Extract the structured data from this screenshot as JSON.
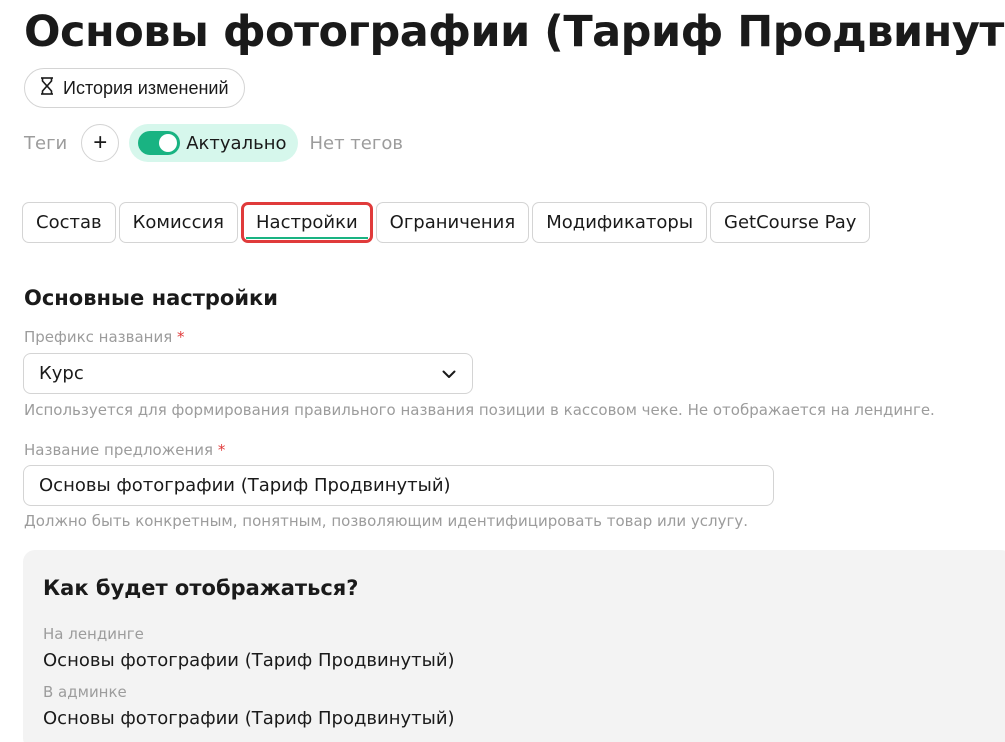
{
  "page": {
    "title": "Основы фотографии (Тариф Продвинутый)"
  },
  "header": {
    "history_label": "История изменений"
  },
  "tags": {
    "label": "Теги",
    "add_symbol": "+",
    "toggle_label": "Актуально",
    "toggle_on": true,
    "empty_text": "Нет тегов"
  },
  "tabs": [
    {
      "label": "Состав",
      "active": false
    },
    {
      "label": "Комиссия",
      "active": false
    },
    {
      "label": "Настройки",
      "active": true
    },
    {
      "label": "Ограничения",
      "active": false
    },
    {
      "label": "Модификаторы",
      "active": false
    },
    {
      "label": "GetCourse Pay",
      "active": false
    }
  ],
  "settings": {
    "section_title": "Основные настройки",
    "prefix": {
      "label": "Префикс названия",
      "required_mark": "*",
      "value": "Курс",
      "hint": "Используется для формирования правильного названия позиции в кассовом чеке. Не отображается на лендинге."
    },
    "offer_name": {
      "label": "Название предложения",
      "required_mark": "*",
      "value": "Основы фотографии (Тариф Продвинутый)",
      "hint": "Должно быть конкретным, понятным, позволяющим идентифицировать товар или услугу."
    }
  },
  "preview": {
    "title": "Как будет отображаться?",
    "landing_label": "На лендинге",
    "landing_value": "Основы фотографии (Тариф Продвинутый)",
    "admin_label": "В админке",
    "admin_value": "Основы фотографии (Тариф Продвинутый)"
  },
  "colors": {
    "accent_green": "#19b382",
    "toggle_bg": "#d6f7ec",
    "highlight_red": "#e03b3b",
    "muted_text": "#9c9c9c"
  }
}
